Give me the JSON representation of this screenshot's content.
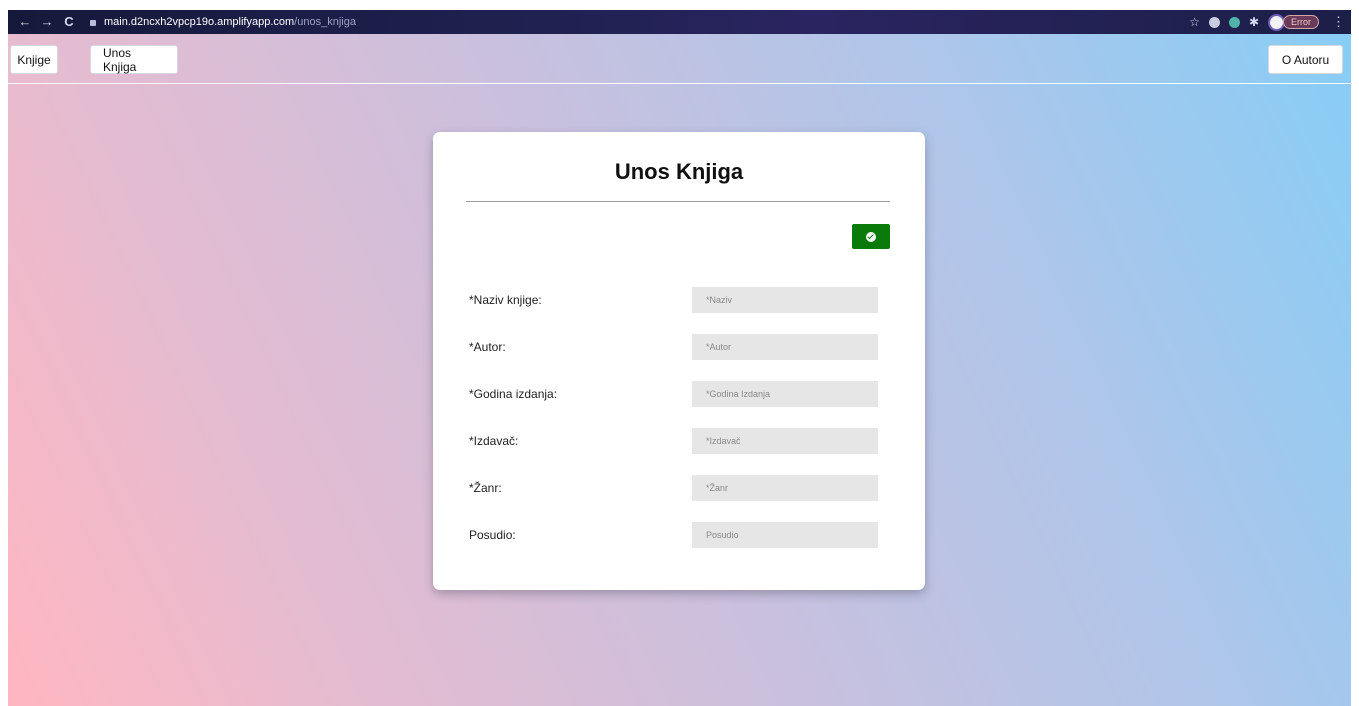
{
  "browser": {
    "back": "←",
    "forward": "→",
    "reload": "C",
    "url_host": "main.d2ncxh2vpcp19o.amplifyapp.com",
    "url_path": "/unos_knjiga",
    "star": "☆",
    "puzzle": "✱",
    "profile_status": "Error",
    "menu": "⋮"
  },
  "nav": {
    "knjige": "Knjige",
    "unos_knjiga": "Unos Knjiga",
    "o_autoru": "O Autoru"
  },
  "form": {
    "title": "Unos Knjiga",
    "fields": [
      {
        "label": "*Naziv knjige:",
        "placeholder": "*Naziv"
      },
      {
        "label": "*Autor:",
        "placeholder": "*Autor"
      },
      {
        "label": "*Godina izdanja:",
        "placeholder": "*Godina Izdanja"
      },
      {
        "label": "*Izdavač:",
        "placeholder": "*Izdavač"
      },
      {
        "label": "*Žanr:",
        "placeholder": "*Žanr"
      },
      {
        "label": "Posudio:",
        "placeholder": "Posudio"
      }
    ]
  },
  "colors": {
    "save_button": "#0a7a0a",
    "input_bg": "#e6e6e6"
  },
  "icons": {
    "save": "check-circle-icon"
  }
}
